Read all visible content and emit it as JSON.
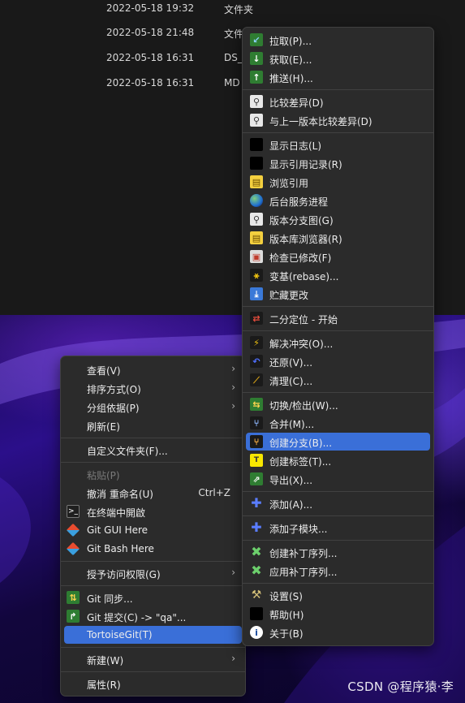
{
  "files": [
    {
      "date": "2022-05-18 19:32",
      "type": "文件夹"
    },
    {
      "date": "2022-05-18 21:48",
      "type": "文件"
    },
    {
      "date": "2022-05-18 16:31",
      "type": "DS_"
    },
    {
      "date": "2022-05-18 16:31",
      "type": "MD"
    }
  ],
  "context_menu": {
    "view": "查看(V)",
    "sort_by": "排序方式(O)",
    "group_by": "分组依据(P)",
    "refresh": "刷新(E)",
    "customize_folder": "自定义文件夹(F)...",
    "paste": "粘贴(P)",
    "undo_rename": "撤消 重命名(U)",
    "undo_shortcut": "Ctrl+Z",
    "open_in_terminal": "在终端中開啟",
    "git_gui_here": "Git GUI Here",
    "git_bash_here": "Git Bash Here",
    "give_access": "授予访问权限(G)",
    "git_sync": "Git 同步...",
    "git_commit": "Git 提交(C) -> \"qa\"...",
    "tortoisegit": "TortoiseGit(T)",
    "new": "新建(W)",
    "properties": "属性(R)"
  },
  "tortoise_menu": {
    "pull": "拉取(P)...",
    "fetch": "获取(E)...",
    "push": "推送(H)...",
    "diff": "比较差异(D)",
    "diff_prev": "与上一版本比较差异(D)",
    "show_log": "显示日志(L)",
    "show_reflog": "显示引用记录(R)",
    "browse_refs": "浏览引用",
    "daemon": "后台服务进程",
    "revision_graph": "版本分支图(G)",
    "repo_browser": "版本库浏览器(R)",
    "check_mods": "检查已修改(F)",
    "rebase": "变基(rebase)...",
    "stash": "贮藏更改",
    "bisect": "二分定位 - 开始",
    "resolve": "解决冲突(O)...",
    "revert": "还原(V)...",
    "clean": "清理(C)...",
    "switch": "切换/检出(W)...",
    "merge": "合并(M)...",
    "create_branch": "创建分支(B)...",
    "create_tag": "创建标签(T)...",
    "export": "导出(X)...",
    "add": "添加(A)...",
    "add_submodule": "添加子模块...",
    "create_patch": "创建补丁序列...",
    "apply_patch": "应用补丁序列...",
    "settings": "设置(S)",
    "help": "帮助(H)",
    "about": "关于(B)"
  },
  "watermark": "CSDN @程序猿·李",
  "colors": {
    "highlight": "#3a6fd8",
    "menu_bg": "#2b2b2b",
    "explorer_bg": "#191919"
  }
}
